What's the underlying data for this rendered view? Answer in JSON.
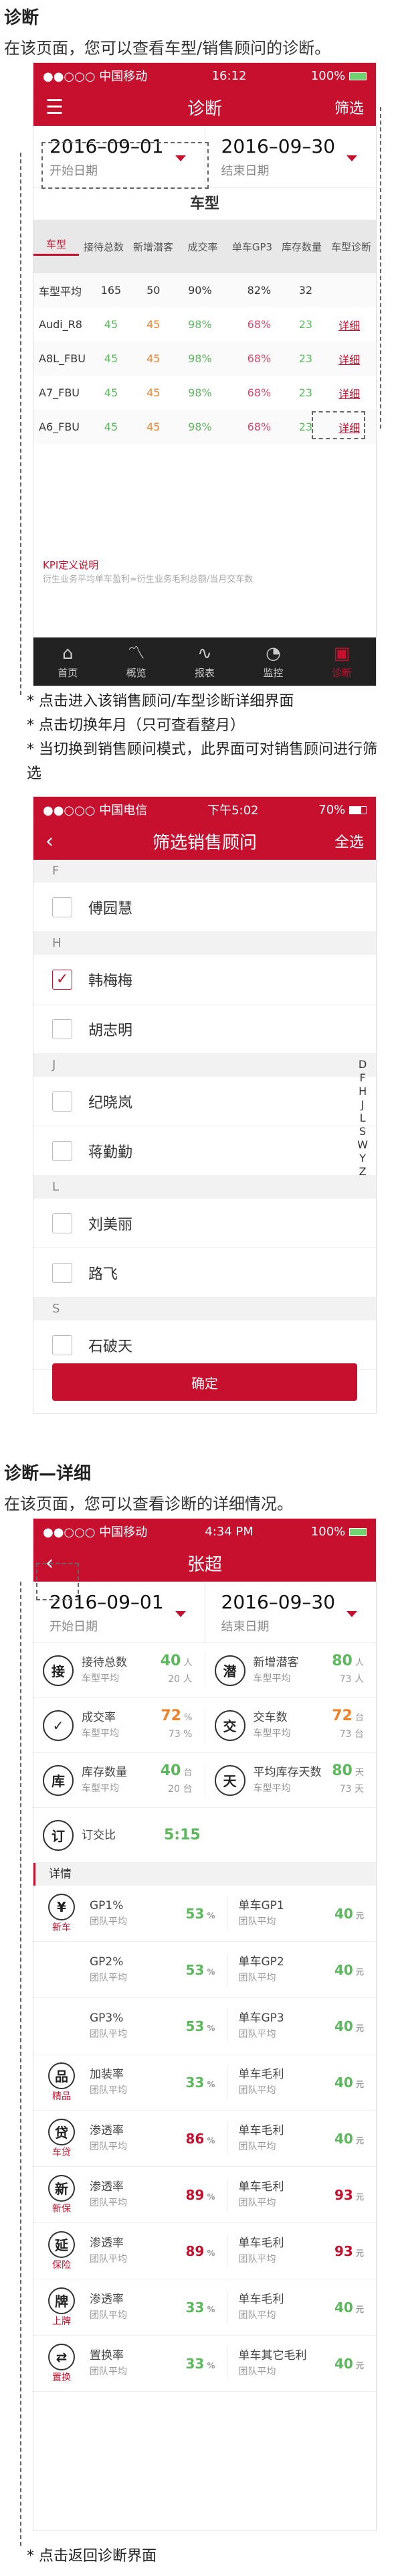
{
  "section1": {
    "title": "诊断",
    "desc": "在该页面，您可以查看车型/销售顾问的诊断。",
    "status": {
      "carrier": "●●○○○ 中国移动",
      "time": "16:12",
      "battery": "100%"
    },
    "nav": {
      "title": "诊断",
      "right": "筛选"
    },
    "dates": [
      {
        "value": "2016–09–01",
        "label": "开始日期"
      },
      {
        "value": "2016–09–30",
        "label": "结束日期"
      }
    ],
    "toggle_label": "车型",
    "table": {
      "headers": [
        "车型",
        "接待总数",
        "新增潜客",
        "成交率",
        "单车GP3",
        "库存数量",
        "车型诊断"
      ],
      "rows": [
        {
          "name": "车型平均",
          "v": [
            "165",
            "50",
            "90%",
            "82%",
            "32"
          ],
          "action": ""
        },
        {
          "name": "Audi_R8",
          "v": [
            "45",
            "45",
            "98%",
            "68%",
            "23"
          ],
          "action": "详细"
        },
        {
          "name": "A8L_FBU",
          "v": [
            "45",
            "45",
            "98%",
            "68%",
            "23"
          ],
          "action": "详细"
        },
        {
          "name": "A7_FBU",
          "v": [
            "45",
            "45",
            "98%",
            "68%",
            "23"
          ],
          "action": "详细"
        },
        {
          "name": "A6_FBU",
          "v": [
            "45",
            "45",
            "98%",
            "68%",
            "23"
          ],
          "action": "详细"
        }
      ]
    },
    "kpi_title": "KPI定义说明",
    "kpi_text": "衍生业务平均单车盈利=衍生业务毛利总额/当月交车数",
    "tabs": [
      "首页",
      "概览",
      "报表",
      "监控",
      "诊断"
    ],
    "notes": [
      "*  点击进入该销售顾问/车型诊断详细界面",
      "*  点击切换年月（只可查看整月）",
      "*  当切换到销售顾问模式，此界面可对销售顾问进行筛选"
    ]
  },
  "section2": {
    "status": {
      "carrier": "●●○○○ 中国电信",
      "time": "下午5:02",
      "battery": "70%"
    },
    "nav": {
      "title": "筛选销售顾问",
      "right": "全选"
    },
    "groups": [
      {
        "letter": "F",
        "names": [
          "傅园慧"
        ]
      },
      {
        "letter": "H",
        "names": [
          "韩梅梅",
          "胡志明"
        ]
      },
      {
        "letter": "J",
        "names": [
          "纪晓岚",
          "蒋勤勤"
        ]
      },
      {
        "letter": "L",
        "names": [
          "刘美丽",
          "路飞"
        ]
      },
      {
        "letter": "S",
        "names": [
          "石破天"
        ]
      }
    ],
    "index_letters": [
      "D",
      "F",
      "H",
      "J",
      "L",
      "S",
      "W",
      "Y",
      "Z"
    ],
    "confirm": "确定"
  },
  "section3": {
    "title": "诊断—详细",
    "desc": "在该页面，您可以查看诊断的详细情况。",
    "status": {
      "carrier": "●●○○○ 中国移动",
      "time": "4:34 PM",
      "battery": "100%"
    },
    "nav": {
      "title": "张超"
    },
    "dates": [
      {
        "value": "2016–09–01",
        "label": "开始日期"
      },
      {
        "value": "2016–09–30",
        "label": "结束日期"
      }
    ],
    "metrics": [
      [
        {
          "icon": "接",
          "label": "接待总数",
          "sub": "车型平均",
          "val": "40",
          "unit": "人",
          "avg": "20 人",
          "color": "grn"
        },
        {
          "icon": "潜",
          "label": "新增潜客",
          "sub": "车型平均",
          "val": "80",
          "unit": "人",
          "avg": "73 人",
          "color": "grn"
        }
      ],
      [
        {
          "icon": "✓",
          "label": "成交率",
          "sub": "车型平均",
          "val": "72",
          "unit": "%",
          "avg": "73 %",
          "color": "org"
        },
        {
          "icon": "交",
          "label": "交车数",
          "sub": "车型平均",
          "val": "72",
          "unit": "台",
          "avg": "73 台",
          "color": "org"
        }
      ],
      [
        {
          "icon": "库",
          "label": "库存数量",
          "sub": "车型平均",
          "val": "40",
          "unit": "台",
          "avg": "20 台",
          "color": "grn"
        },
        {
          "icon": "天",
          "label": "平均库存天数",
          "sub": "车型平均",
          "val": "80",
          "unit": "天",
          "avg": "73 天",
          "color": "grn"
        }
      ]
    ],
    "order_ratio": {
      "label": "订交比",
      "val": "5:15"
    },
    "detail_title": "详情",
    "details": [
      {
        "icon": "¥",
        "name": "新车",
        "rows": [
          [
            "GP1%",
            "53",
            "%",
            "单车GP1",
            "40",
            "元"
          ],
          [
            "GP2%",
            "53",
            "%",
            "单车GP2",
            "40",
            "元"
          ],
          [
            "GP3%",
            "53",
            "%",
            "单车GP3",
            "40",
            "元"
          ]
        ]
      },
      {
        "icon": "品",
        "name": "精品",
        "rows": [
          [
            "加装率",
            "33",
            "%",
            "单车毛利",
            "40",
            "元"
          ]
        ]
      },
      {
        "icon": "贷",
        "name": "车贷",
        "rows": [
          [
            "渗透率",
            "86",
            "%",
            "单车毛利",
            "40",
            "元"
          ]
        ]
      },
      {
        "icon": "新",
        "name": "新保",
        "rows": [
          [
            "渗透率",
            "89",
            "%",
            "单车毛利",
            "93",
            "元"
          ]
        ]
      },
      {
        "icon": "延",
        "name": "保险",
        "rows": [
          [
            "渗透率",
            "89",
            "%",
            "单车毛利",
            "93",
            "元"
          ]
        ]
      },
      {
        "icon": "牌",
        "name": "上牌",
        "rows": [
          [
            "渗透率",
            "33",
            "%",
            "单车毛利",
            "40",
            "元"
          ]
        ]
      },
      {
        "icon": "⇄",
        "name": "置换",
        "rows": [
          [
            "置换率",
            "33",
            "%",
            "单车其它毛利",
            "40",
            "元"
          ]
        ]
      }
    ],
    "sub_avg": "团队平均",
    "note": "*  点击返回诊断界面"
  }
}
